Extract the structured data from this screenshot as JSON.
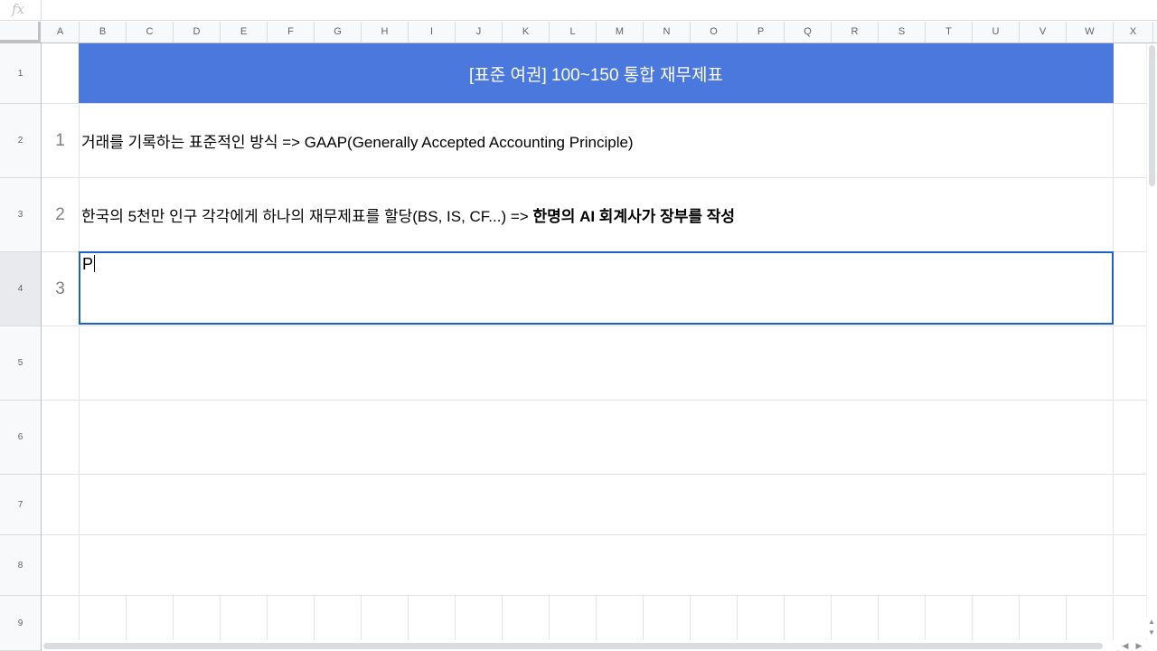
{
  "formula_bar": {
    "icon": "fx-icon",
    "icon_glyph": "fx",
    "value": ""
  },
  "columns": [
    "A",
    "B",
    "C",
    "D",
    "E",
    "F",
    "G",
    "H",
    "I",
    "J",
    "K",
    "L",
    "M",
    "N",
    "O",
    "P",
    "Q",
    "R",
    "S",
    "T",
    "U",
    "V",
    "W",
    "X"
  ],
  "rows": [
    "1",
    "2",
    "3",
    "4",
    "5",
    "6",
    "7",
    "8",
    "9"
  ],
  "active_row": "4",
  "sheet": {
    "title": "[표준 여권] 100~150 통합 재무제표",
    "title_bg": "#4a78dc",
    "items": [
      {
        "number": "1",
        "text": "거래를 기록하는 표준적인 방식 => GAAP(Generally Accepted Accounting Principle)",
        "bold_text": ""
      },
      {
        "number": "2",
        "text": "한국의 5천만 인구 각각에게 하나의 재무제표를 할당(BS, IS, CF...) => ",
        "bold_text": "한명의 AI 회계사가 장부를 작성"
      }
    ],
    "editing": {
      "number": "3",
      "text": "P"
    },
    "selection_color": "#1a62c7"
  }
}
